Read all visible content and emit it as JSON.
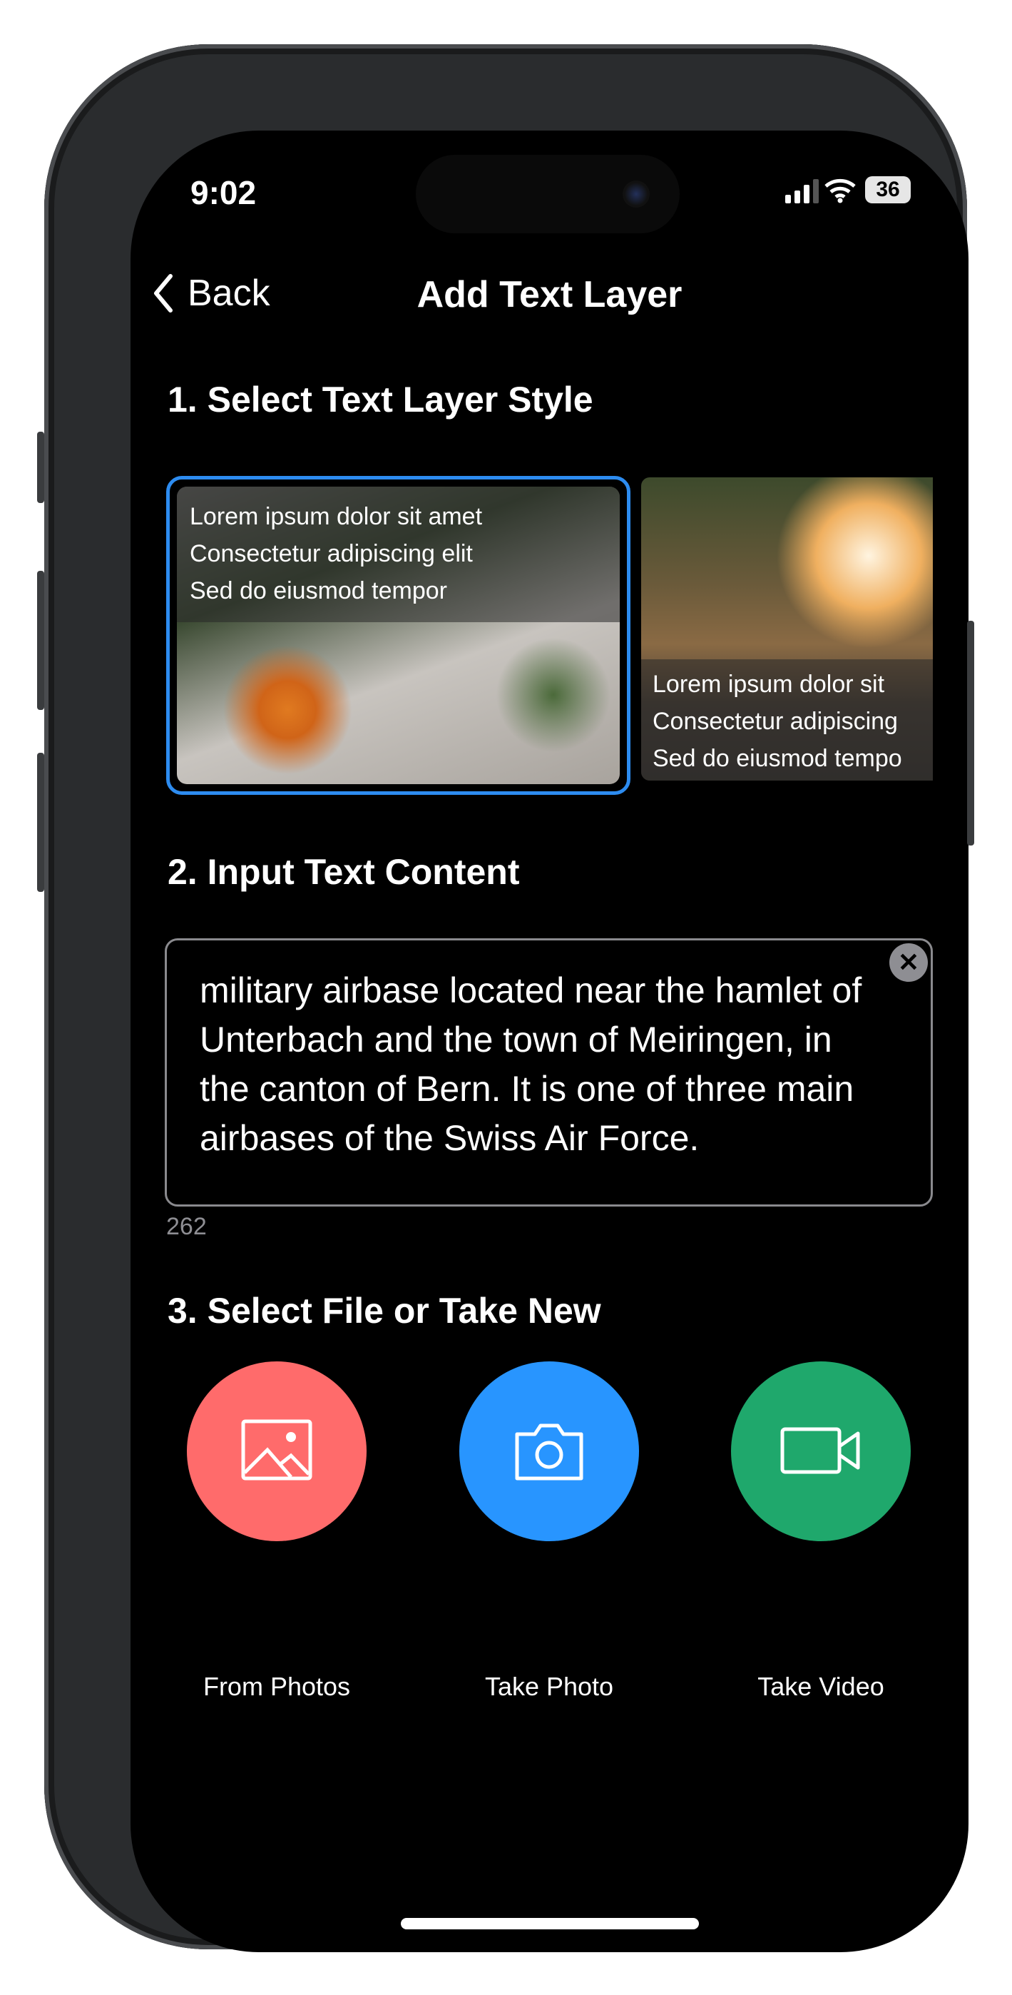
{
  "status_bar": {
    "time": "9:02",
    "battery": "36"
  },
  "nav": {
    "back_label": "Back",
    "title": "Add Text Layer"
  },
  "section1": {
    "heading": "1. Select Text Layer Style",
    "styles": [
      {
        "lines": [
          "Lorem ipsum dolor sit amet",
          "Consectetur adipiscing elit",
          "Sed do eiusmod tempor"
        ],
        "selected": true
      },
      {
        "lines": [
          "Lorem ipsum dolor sit",
          "Consectetur adipiscing",
          "Sed do eiusmod tempo"
        ],
        "selected": false
      }
    ]
  },
  "section2": {
    "heading": "2. Input Text Content",
    "text_value": "military airbase located near the hamlet of Unterbach and the town of Meiringen, in the canton of Bern. It is one of three main airbases of the Swiss Air Force.",
    "char_count": "262"
  },
  "section3": {
    "heading": "3. Select File or Take New",
    "options": [
      {
        "label": "From Photos",
        "icon": "image-icon",
        "color": "#FF6B6B"
      },
      {
        "label": "Take Photo",
        "icon": "camera-icon",
        "color": "#2895FF"
      },
      {
        "label": "Take Video",
        "icon": "video-icon",
        "color": "#1FA86C"
      }
    ]
  },
  "accent": "#2D8CF0"
}
